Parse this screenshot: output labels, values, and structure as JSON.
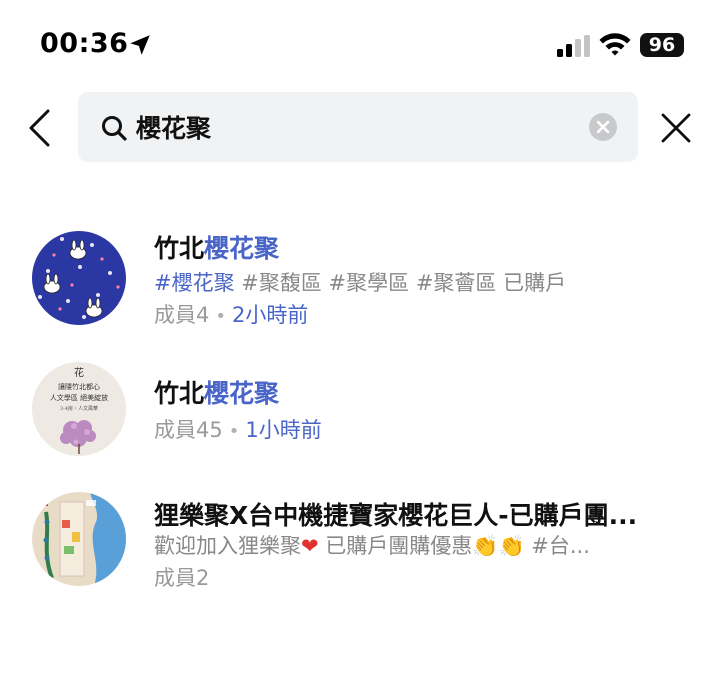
{
  "status_bar": {
    "time": "00:36",
    "battery": "96"
  },
  "search": {
    "query": "櫻花聚"
  },
  "results": [
    {
      "title_prefix": "竹北",
      "title_highlight": "櫻花聚",
      "tags_highlight": "#櫻花聚",
      "tags_rest": " #聚馥區 #聚學區 #聚薈區 已購戶",
      "members": "成員4",
      "dot": "•",
      "time_ago": "2小時前"
    },
    {
      "title_prefix": "竹北",
      "title_highlight": "櫻花聚",
      "members": "成員45",
      "dot": "•",
      "time_ago": "1小時前",
      "avatar_text": {
        "line0": "花",
        "line1": "讓隱竹北都心",
        "line2": "人文學區 絕美綻放",
        "line3": "3-4房・人文風華"
      }
    },
    {
      "title": "狸樂聚X台中機捷寶家櫻花巨人-已購戶團...",
      "desc_a": "歡迎加入狸樂聚",
      "desc_b": " 已購戶團購優惠",
      "desc_c": " #台...",
      "heart": "❤",
      "clap": "👏",
      "members": "成員2"
    }
  ],
  "colors": {
    "highlight": "#4a65c8",
    "secondary": "#888888",
    "search_bg": "#f1f2f3"
  }
}
